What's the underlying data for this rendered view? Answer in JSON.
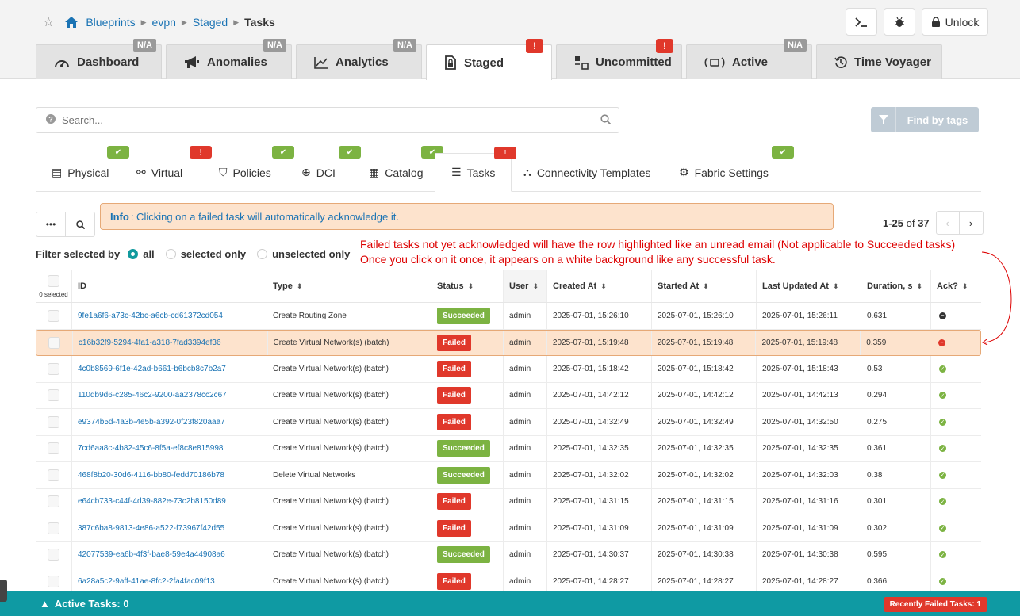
{
  "breadcrumb": [
    "Blueprints",
    "evpn",
    "Staged",
    "Tasks"
  ],
  "top_actions": {
    "unlock_label": "Unlock"
  },
  "main_tabs": [
    {
      "label": "Dashboard",
      "badge": "N/A",
      "icon": "gauge-icon"
    },
    {
      "label": "Anomalies",
      "badge": "N/A",
      "icon": "megaphone-icon"
    },
    {
      "label": "Analytics",
      "badge": "N/A",
      "icon": "chart-line-icon"
    },
    {
      "label": "Staged",
      "badge": "!",
      "icon": "document-lock-icon"
    },
    {
      "label": "Uncommitted",
      "badge": "!",
      "icon": "diff-icon"
    },
    {
      "label": "Active",
      "badge": "N/A",
      "icon": "active-icon"
    },
    {
      "label": "Time Voyager",
      "badge": "",
      "icon": "history-icon"
    }
  ],
  "search": {
    "placeholder": "Search..."
  },
  "find_by_tags": "Find by tags",
  "sub_tabs": [
    {
      "label": "Physical",
      "status": "ok"
    },
    {
      "label": "Virtual",
      "status": "warn"
    },
    {
      "label": "Policies",
      "status": "ok"
    },
    {
      "label": "DCI",
      "status": "ok"
    },
    {
      "label": "Catalog",
      "status": "ok"
    },
    {
      "label": "Tasks",
      "status": "warn"
    },
    {
      "label": "Connectivity Templates",
      "status": ""
    },
    {
      "label": "Fabric Settings",
      "status": "ok"
    }
  ],
  "toolbar": {
    "more_label": "•••"
  },
  "info": {
    "prefix": "Info",
    "text": ": Clicking on a failed task will automatically acknowledge it."
  },
  "pager": {
    "range": "1-25",
    "of": "of",
    "total": "37"
  },
  "filter": {
    "label": "Filter selected by",
    "options": [
      "all",
      "selected only",
      "unselected only"
    ],
    "selected": "all"
  },
  "annotation": {
    "line1": "Failed tasks not yet acknowledged will have the row highlighted like an unread email (Not applicable to Succeeded tasks)",
    "line2": "Once you click on it once, it appears on a white background like any successful task."
  },
  "table": {
    "selected_count": "0 selected",
    "columns": [
      "ID",
      "Type",
      "Status",
      "User",
      "Created At",
      "Started At",
      "Last Updated At",
      "Duration, s",
      "Ack?"
    ],
    "rows": [
      {
        "id": "9fe1a6f6-a73c-42bc-a6cb-cd61372cd054",
        "type": "Create Routing Zone",
        "status": "Succeeded",
        "user": "admin",
        "created": "2025-07-01, 15:26:10",
        "started": "2025-07-01, 15:26:10",
        "updated": "2025-07-01, 15:26:11",
        "duration": "0.631",
        "ack": "none"
      },
      {
        "id": "c16b32f9-5294-4fa1-a318-7fad3394ef36",
        "type": "Create Virtual Network(s) (batch)",
        "status": "Failed",
        "user": "admin",
        "created": "2025-07-01, 15:19:48",
        "started": "2025-07-01, 15:19:48",
        "updated": "2025-07-01, 15:19:48",
        "duration": "0.359",
        "ack": "no"
      },
      {
        "id": "4c0b8569-6f1e-42ad-b661-b6bcb8c7b2a7",
        "type": "Create Virtual Network(s) (batch)",
        "status": "Failed",
        "user": "admin",
        "created": "2025-07-01, 15:18:42",
        "started": "2025-07-01, 15:18:42",
        "updated": "2025-07-01, 15:18:43",
        "duration": "0.53",
        "ack": "yes"
      },
      {
        "id": "110db9d6-c285-46c2-9200-aa2378cc2c67",
        "type": "Create Virtual Network(s) (batch)",
        "status": "Failed",
        "user": "admin",
        "created": "2025-07-01, 14:42:12",
        "started": "2025-07-01, 14:42:12",
        "updated": "2025-07-01, 14:42:13",
        "duration": "0.294",
        "ack": "yes"
      },
      {
        "id": "e9374b5d-4a3b-4e5b-a392-0f23f820aaa7",
        "type": "Create Virtual Network(s) (batch)",
        "status": "Failed",
        "user": "admin",
        "created": "2025-07-01, 14:32:49",
        "started": "2025-07-01, 14:32:49",
        "updated": "2025-07-01, 14:32:50",
        "duration": "0.275",
        "ack": "yes"
      },
      {
        "id": "7cd6aa8c-4b82-45c6-8f5a-ef8c8e815998",
        "type": "Create Virtual Network(s) (batch)",
        "status": "Succeeded",
        "user": "admin",
        "created": "2025-07-01, 14:32:35",
        "started": "2025-07-01, 14:32:35",
        "updated": "2025-07-01, 14:32:35",
        "duration": "0.361",
        "ack": "yes"
      },
      {
        "id": "468f8b20-30d6-4116-bb80-fedd70186b78",
        "type": "Delete Virtual Networks",
        "status": "Succeeded",
        "user": "admin",
        "created": "2025-07-01, 14:32:02",
        "started": "2025-07-01, 14:32:02",
        "updated": "2025-07-01, 14:32:03",
        "duration": "0.38",
        "ack": "yes"
      },
      {
        "id": "e64cb733-c44f-4d39-882e-73c2b8150d89",
        "type": "Create Virtual Network(s) (batch)",
        "status": "Failed",
        "user": "admin",
        "created": "2025-07-01, 14:31:15",
        "started": "2025-07-01, 14:31:15",
        "updated": "2025-07-01, 14:31:16",
        "duration": "0.301",
        "ack": "yes"
      },
      {
        "id": "387c6ba8-9813-4e86-a522-f73967f42d55",
        "type": "Create Virtual Network(s) (batch)",
        "status": "Failed",
        "user": "admin",
        "created": "2025-07-01, 14:31:09",
        "started": "2025-07-01, 14:31:09",
        "updated": "2025-07-01, 14:31:09",
        "duration": "0.302",
        "ack": "yes"
      },
      {
        "id": "42077539-ea6b-4f3f-bae8-59e4a44908a6",
        "type": "Create Virtual Network(s) (batch)",
        "status": "Succeeded",
        "user": "admin",
        "created": "2025-07-01, 14:30:37",
        "started": "2025-07-01, 14:30:38",
        "updated": "2025-07-01, 14:30:38",
        "duration": "0.595",
        "ack": "yes"
      },
      {
        "id": "6a28a5c2-9aff-41ae-8fc2-2fa4fac09f13",
        "type": "Create Virtual Network(s) (batch)",
        "status": "Failed",
        "user": "admin",
        "created": "2025-07-01, 14:28:27",
        "started": "2025-07-01, 14:28:27",
        "updated": "2025-07-01, 14:28:27",
        "duration": "0.366",
        "ack": "yes"
      }
    ]
  },
  "bottom": {
    "active_tasks": "Active Tasks: 0",
    "recent_failed": "Recently Failed Tasks: 1"
  },
  "colors": {
    "accent": "#0f9aa3",
    "link": "#1a73b4",
    "success": "#7cb342",
    "danger": "#e0382b",
    "highlight": "#fde3cd"
  }
}
